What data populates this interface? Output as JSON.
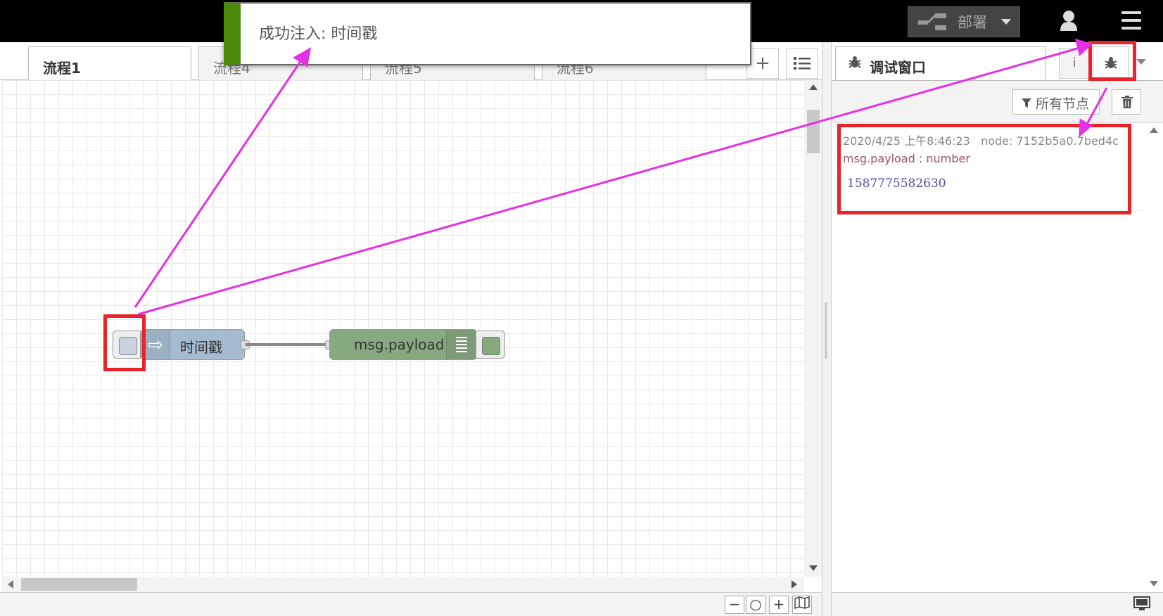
{
  "header": {
    "deploy_label": "部署"
  },
  "notification": {
    "text": "成功注入: 时间戳"
  },
  "workspace": {
    "tabs": [
      {
        "label": "流程1"
      },
      {
        "label": "流程4"
      },
      {
        "label": "流程5"
      },
      {
        "label": "流程6"
      }
    ],
    "add_tab_symbol": "+"
  },
  "flow": {
    "inject_node": {
      "label": "时间戳"
    },
    "debug_node": {
      "label": "msg.payload"
    }
  },
  "sidebar": {
    "tab_label": "调试窗口",
    "info_symbol": "i",
    "filter_label": "所有节点",
    "message": {
      "timestamp": "2020/4/25 上午8:46:23",
      "node": "node: 7152b5a0.7bed4c",
      "path": "msg.payload : number",
      "value": "1587775582630"
    }
  },
  "zoom_controls": {
    "zoom_out": "−",
    "zoom_reset": "○",
    "zoom_in": "+"
  },
  "colors": {
    "annotation_arrow": "#e530e5",
    "highlight_box": "#e8232a",
    "notification_accent": "#4b8a0b",
    "inject_node": "#a6bbcf",
    "debug_node": "#87a980"
  }
}
